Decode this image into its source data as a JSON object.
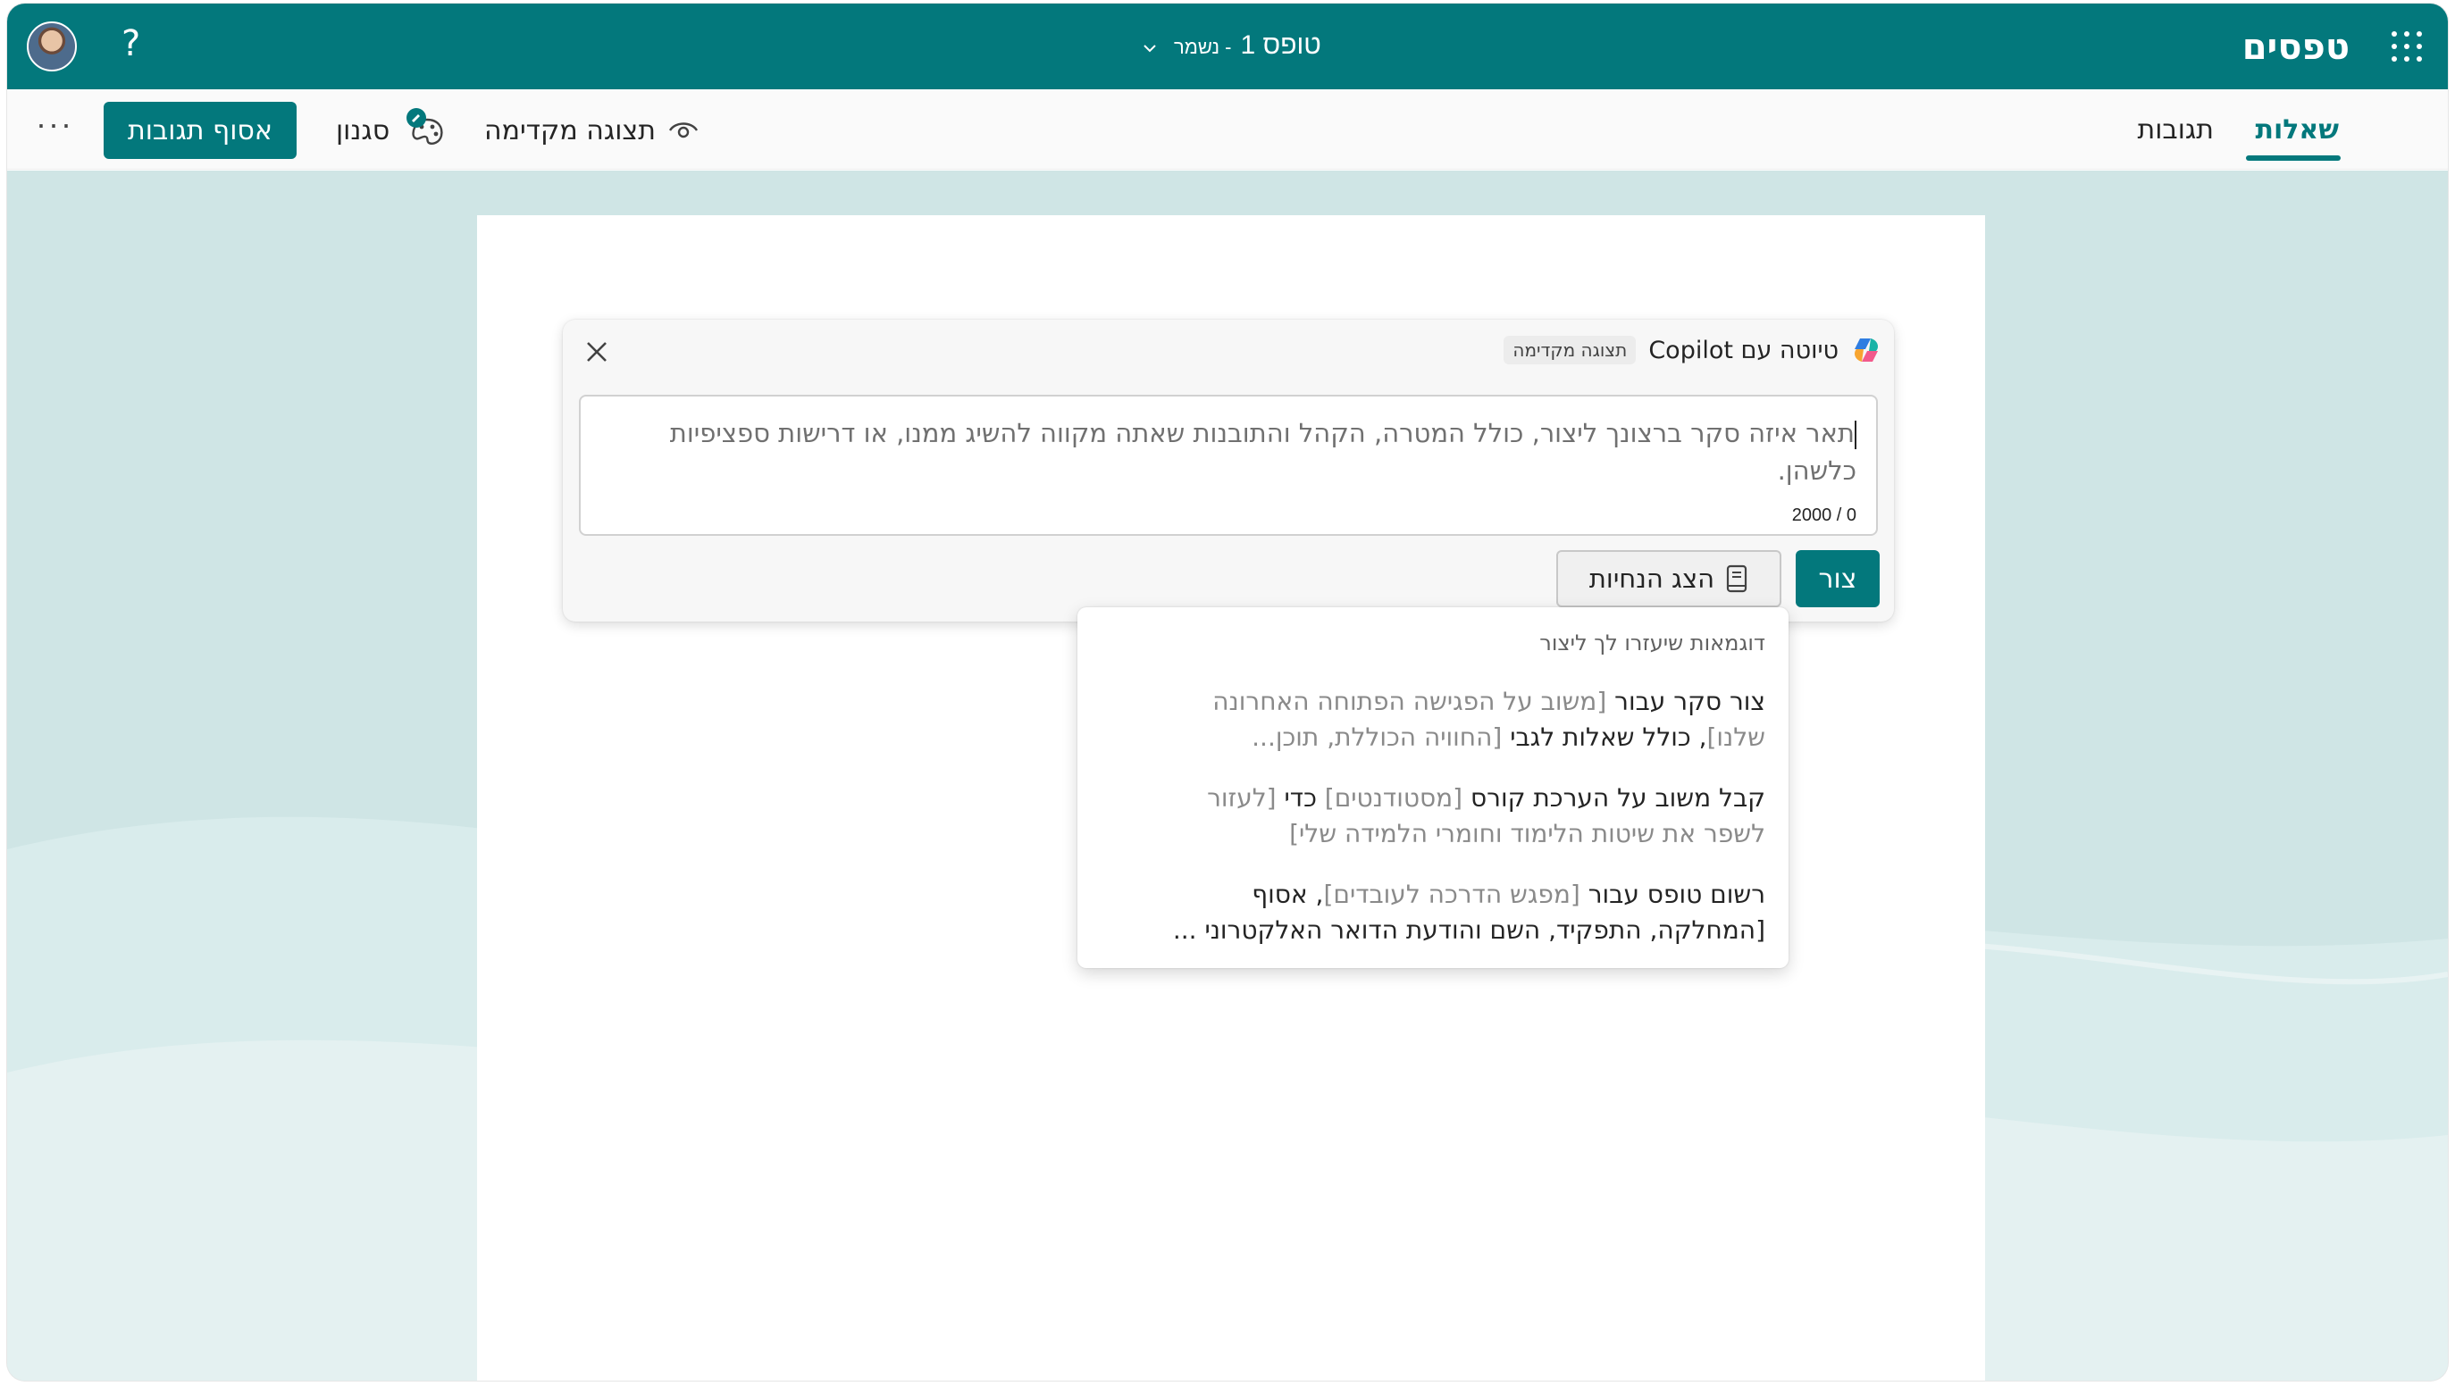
{
  "header": {
    "app_name": "טפסים",
    "form_name": "טופס 1",
    "save_status": "- נשמר",
    "help": "?"
  },
  "commandbar": {
    "tabs": [
      {
        "label": "שאלות",
        "active": true
      },
      {
        "label": "תגובות",
        "active": false
      }
    ],
    "preview_label": "תצוגה מקדימה",
    "style_label": "סגנון",
    "collect_label": "אסוף תגובות",
    "more": "···"
  },
  "copilot": {
    "title": "טיוטה עם Copilot",
    "badge": "תצוגה מקדימה",
    "prompt_placeholder": "תאר איזה סקר ברצונך ליצור, כולל המטרה, הקהל והתובנות שאתה מקווה להשיג ממנו, או דרישות ספציפיות כלשהן.",
    "counter": "2000 / 0",
    "create_label": "צור",
    "guides_label": "הצג הנחיות"
  },
  "suggestions": {
    "heading": "דוגמאות שיעזרו לך ליצור",
    "items": [
      {
        "l1_dark": "צור סקר עבור",
        "l1_light": "[משוב על הפגישה הפתוחה האחרונה",
        "l2_light_a": "שלנו]",
        "l2_dark": ", כולל שאלות לגבי",
        "l2_light_b": "[החוויה הכוללת, תוכן..."
      },
      {
        "l1_dark": "קבל משוב על הערכת קורס",
        "l1_light": "[מסטודנטים]",
        "l1_dark_b": "כדי",
        "l1_light_b": "[לעזור",
        "l2_light_a": "לשפר את שיטות הלימוד וחומרי הלמידה שלי]"
      },
      {
        "l1_dark": "רשום טופס עבור",
        "l1_light": "[מפגש הדרכה לעובדים]",
        "l1_dark_b": ", אסוף",
        "l2_dark": "[המחלקה, התפקיד, השם והודעת הדואר האלקטרוני ..."
      }
    ]
  },
  "colors": {
    "brand": "#03787c",
    "canvas": "#cfe5e5"
  }
}
